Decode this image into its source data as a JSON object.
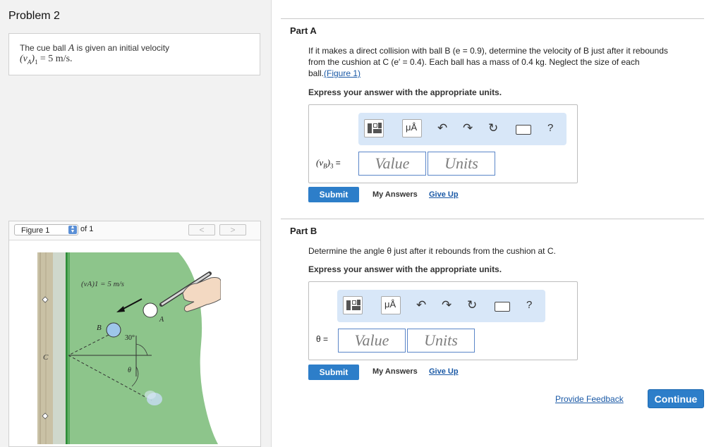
{
  "problem": {
    "title": "Problem 2",
    "statement_text": "The cue ball",
    "statement_var": "A",
    "statement_rest": "is given an initial velocity",
    "statement_math_var": "(vA)1",
    "statement_math_value": "= 5 m/s."
  },
  "figure": {
    "selector_label": "Figure 1",
    "of_label": "of 1",
    "prev_icon": "chevron-left-icon",
    "next_icon": "chevron-right-icon",
    "labels": {
      "velocity": "(vA)1 = 5 m/s",
      "ball_a": "A",
      "ball_b": "B",
      "cushion": "C",
      "angle_30": "30°",
      "angle_theta": "θ"
    },
    "colors": {
      "table": "#8dc58b",
      "rail": "#2e8f3a",
      "wood": "#c9c1a5"
    }
  },
  "part_a": {
    "title": "Part A",
    "prompt_line1": "If it makes a direct collision with ball B (e = 0.9), determine the velocity of B just after it rebounds",
    "prompt_line2": "from the cushion at C (e′ = 0.4). Each ball has a mass of 0.4 kg. Neglect the size of each",
    "prompt_line3_text": "ball.",
    "figure_link": "(Figure 1)",
    "instruction": "Express your answer with the appropriate units.",
    "answer_label": "(vB)3 =",
    "value_placeholder": "Value",
    "units_placeholder": "Units",
    "submit_label": "Submit",
    "my_answers_label": "My Answers",
    "give_up_label": "Give Up"
  },
  "part_b": {
    "title": "Part B",
    "prompt": "Determine the angle θ just after it rebounds from the cushion at C.",
    "instruction": "Express your answer with the appropriate units.",
    "answer_label": "θ =",
    "value_placeholder": "Value",
    "units_placeholder": "Units",
    "submit_label": "Submit",
    "my_answers_label": "My Answers",
    "give_up_label": "Give Up"
  },
  "toolbar": {
    "units_button_label": "μÅ",
    "help_label": "?",
    "icons": [
      "templates-icon",
      "units-icon",
      "undo-icon",
      "redo-icon",
      "reset-icon",
      "keyboard-icon",
      "help-icon"
    ]
  },
  "footer": {
    "feedback_label": "Provide Feedback",
    "continue_label": "Continue"
  },
  "colors": {
    "primary": "#2d7ec9",
    "link": "#1a59a6",
    "toolbar_bg": "#d8e7f8"
  }
}
